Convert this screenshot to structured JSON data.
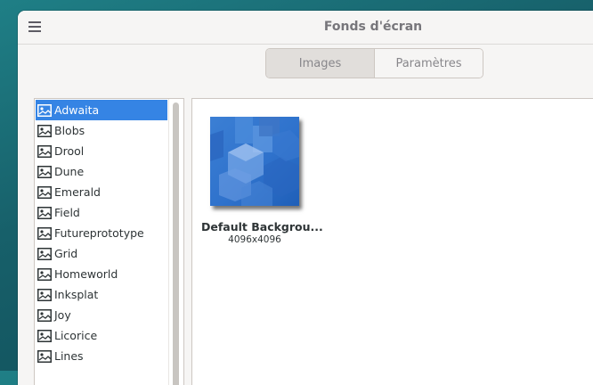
{
  "window": {
    "title": "Fonds d'écran"
  },
  "header": {
    "menu_icon": "hamburger-menu-icon"
  },
  "switcher": {
    "images_label": "Images",
    "params_label": "Paramètres"
  },
  "sidebar": {
    "items": [
      {
        "label": "Adwaita",
        "selected": true
      },
      {
        "label": "Blobs"
      },
      {
        "label": "Drool"
      },
      {
        "label": "Dune"
      },
      {
        "label": "Emerald"
      },
      {
        "label": "Field"
      },
      {
        "label": "Futureprototype"
      },
      {
        "label": "Grid"
      },
      {
        "label": "Homeworld"
      },
      {
        "label": "Inksplat"
      },
      {
        "label": "Joy"
      },
      {
        "label": "Licorice"
      },
      {
        "label": "Lines"
      }
    ]
  },
  "main": {
    "wallpaper": {
      "name": "Default Backgrou...",
      "size": "4096x4096"
    }
  },
  "colors": {
    "selection": "#3584e4",
    "window_bg": "#f6f5f4"
  }
}
